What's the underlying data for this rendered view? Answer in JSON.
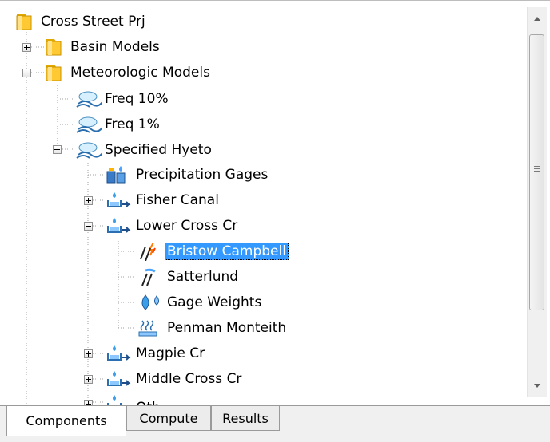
{
  "tree": {
    "nodes": [
      {
        "label": "Cross Street Prj",
        "icon": "folder-icon"
      },
      {
        "label": "Basin Models",
        "icon": "folder-icon"
      },
      {
        "label": "Meteorologic Models",
        "icon": "folder-icon"
      },
      {
        "label": "Freq 10%",
        "icon": "met-model-icon"
      },
      {
        "label": "Freq 1%",
        "icon": "met-model-icon"
      },
      {
        "label": "Specified Hyeto",
        "icon": "met-model-icon"
      },
      {
        "label": "Precipitation Gages",
        "icon": "precip-gages-icon"
      },
      {
        "label": "Fisher Canal",
        "icon": "subbasin-icon"
      },
      {
        "label": "Lower Cross Cr",
        "icon": "subbasin-icon"
      },
      {
        "label": "Bristow Campbell",
        "icon": "lightning-rain-icon",
        "selected": true
      },
      {
        "label": "Satterlund",
        "icon": "rain-icon"
      },
      {
        "label": "Gage Weights",
        "icon": "gage-weights-icon"
      },
      {
        "label": "Penman Monteith",
        "icon": "evaporation-icon"
      },
      {
        "label": "Magpie Cr",
        "icon": "subbasin-icon"
      },
      {
        "label": "Middle Cross Cr",
        "icon": "subbasin-icon"
      },
      {
        "label": "Oth",
        "icon": "subbasin-icon"
      }
    ]
  },
  "tabs": [
    {
      "label": "Components",
      "active": true
    },
    {
      "label": "Compute",
      "active": false
    },
    {
      "label": "Results",
      "active": false
    }
  ]
}
